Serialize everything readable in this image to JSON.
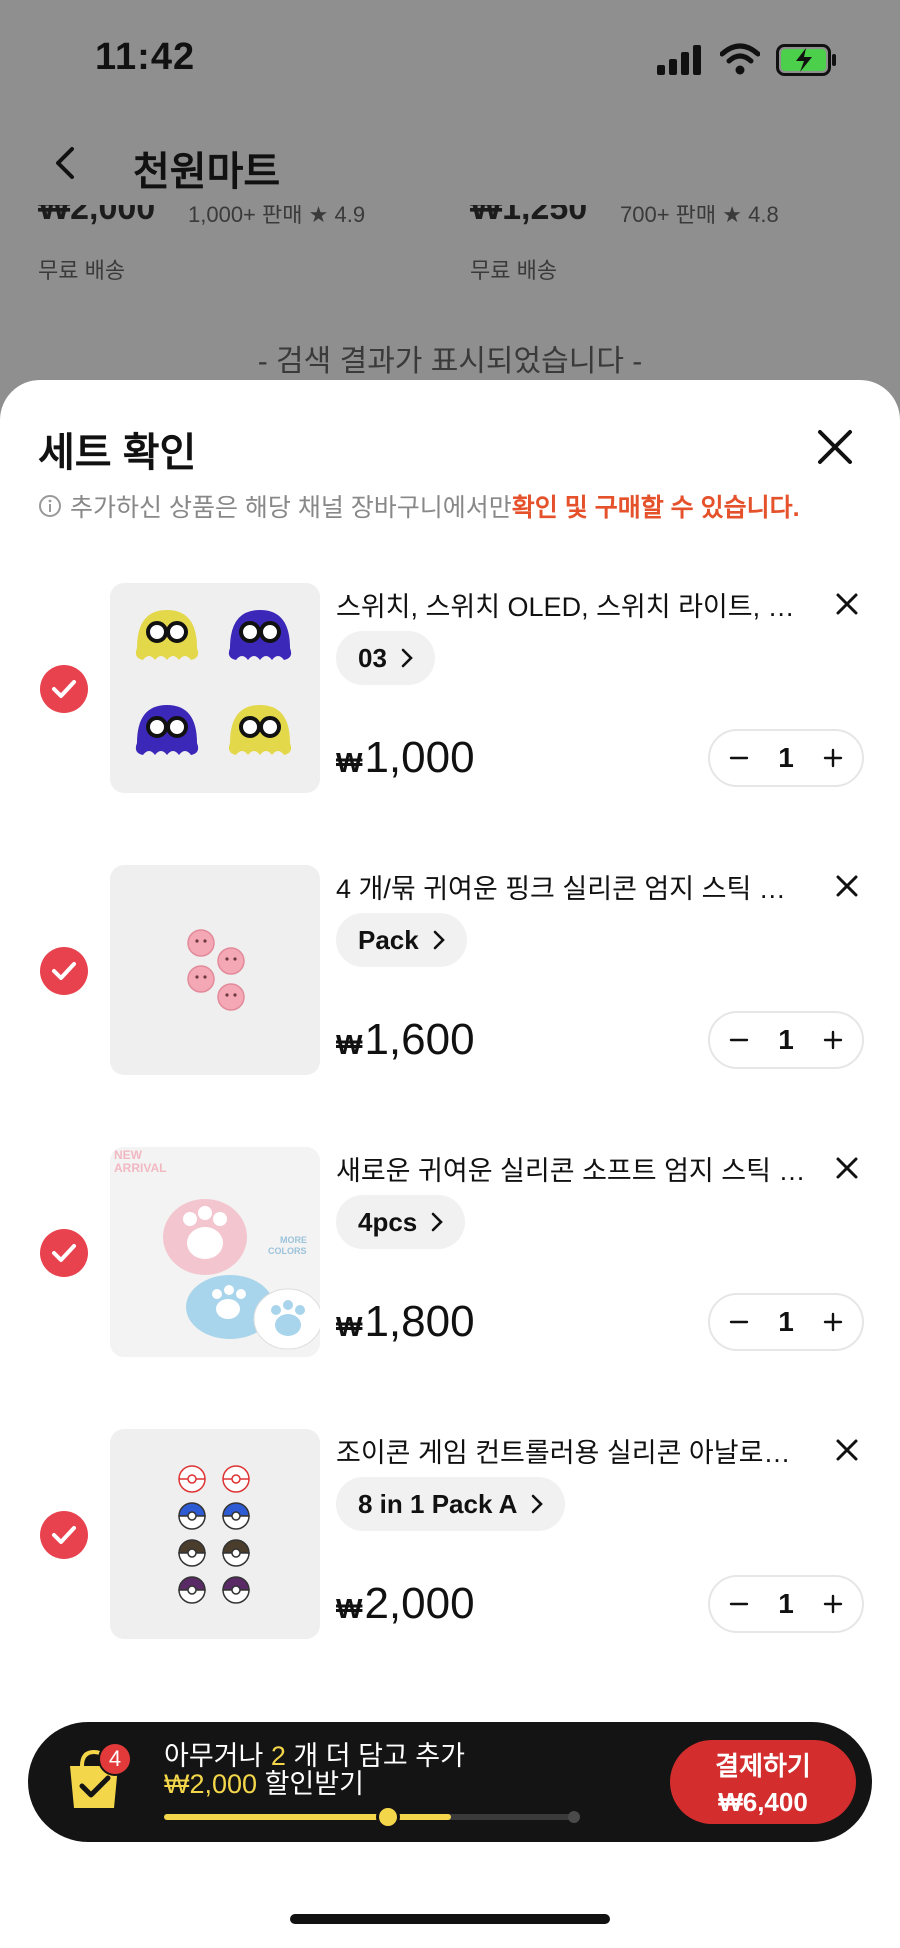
{
  "status_bar": {
    "time": "11:42"
  },
  "nav": {
    "title": "천원마트"
  },
  "background": {
    "products": [
      {
        "price": "₩2,000",
        "sold": "1,000+ 판매",
        "rating": "4.9",
        "shipping": "무료 배송"
      },
      {
        "price": "₩1,250",
        "sold": "700+ 판매",
        "rating": "4.8",
        "shipping": "무료 배송"
      }
    ],
    "result_notice": "- 검색 결과가 표시되었습니다 -"
  },
  "sheet": {
    "title": "세트 확인",
    "notice_plain": "추가하신 상품은 해당 채널 장바구니에서만 ",
    "notice_highlight": "확인 및 구매할 수 있습니다."
  },
  "currency_symbol": "₩",
  "items": [
    {
      "name": "스위치, 스위치 OLED, 스위치 라이트, 닌...",
      "option": "03",
      "price": "1,000",
      "quantity": "1"
    },
    {
      "name": "4 개/묶 귀여운 핑크 실리콘 엄지 스틱 그립 ...",
      "option": "Pack",
      "price": "1,600",
      "quantity": "1"
    },
    {
      "name": "새로운 귀여운 실리콘 소프트 엄지 스틱 그...",
      "option": "4pcs",
      "price": "1,800",
      "quantity": "1"
    },
    {
      "name": "조이콘 게임 컨트롤러용 실리콘 아날로그 엄...",
      "option": "8 in 1 Pack A",
      "price": "2,000",
      "quantity": "1"
    }
  ],
  "thumb_text": {
    "new_arrival": "NEW ARRIVAL",
    "more_colors": "MORE COLORS"
  },
  "promo": {
    "badge_count": "4",
    "text_1": "아무거나 ",
    "text_count": "2",
    "text_2": " 개 더 담고 추가 ",
    "text_amount": "₩2,000",
    "text_3": " 할인받기",
    "progress": 0.7,
    "pay_label": "결제하기",
    "pay_total": "₩6,400"
  },
  "colors": {
    "accent_red": "#e8424f",
    "highlight_orange": "#e4512a",
    "promo_yellow": "#f4d64a",
    "pay_red": "#d42d2d"
  }
}
